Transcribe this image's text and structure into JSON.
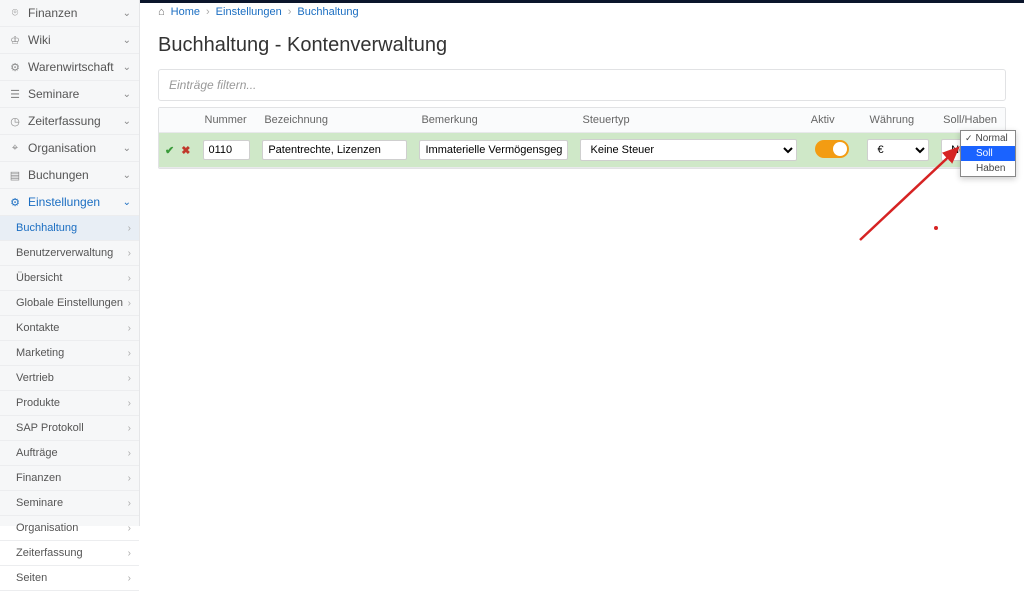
{
  "sidebar": {
    "items": [
      {
        "icon": "⌾",
        "label": "Finanzen"
      },
      {
        "icon": "♔",
        "label": "Wiki"
      },
      {
        "icon": "⚙",
        "label": "Warenwirtschaft"
      },
      {
        "icon": "☰",
        "label": "Seminare"
      },
      {
        "icon": "◷",
        "label": "Zeiterfassung"
      },
      {
        "icon": "⌖",
        "label": "Organisation"
      },
      {
        "icon": "▤",
        "label": "Buchungen"
      },
      {
        "icon": "⚙",
        "label": "Einstellungen",
        "active": true
      }
    ],
    "subitems": [
      {
        "label": "Buchhaltung",
        "active": true
      },
      {
        "label": "Benutzerverwaltung"
      },
      {
        "label": "Übersicht"
      },
      {
        "label": "Globale Einstellungen"
      },
      {
        "label": "Kontakte"
      },
      {
        "label": "Marketing"
      },
      {
        "label": "Vertrieb"
      },
      {
        "label": "Produkte"
      },
      {
        "label": "SAP Protokoll"
      },
      {
        "label": "Aufträge"
      },
      {
        "label": "Finanzen"
      },
      {
        "label": "Seminare"
      },
      {
        "label": "Organisation"
      },
      {
        "label": "Zeiterfassung"
      },
      {
        "label": "Seiten"
      }
    ]
  },
  "breadcrumb": {
    "home": "Home",
    "mid": "Einstellungen",
    "last": "Buchhaltung"
  },
  "page": {
    "title": "Buchhaltung - Kontenverwaltung",
    "filter_placeholder": "Einträge filtern..."
  },
  "table": {
    "headers": {
      "nummer": "Nummer",
      "bezeichnung": "Bezeichnung",
      "bemerkung": "Bemerkung",
      "steuertyp": "Steuertyp",
      "aktiv": "Aktiv",
      "waehrung": "Währung",
      "sollhaben": "Soll/Haben"
    },
    "row": {
      "nummer": "0110",
      "bezeichnung": "Patentrechte, Lizenzen",
      "bemerkung": "Immaterielle Vermögensgegenstände",
      "steuertyp": "Keine Steuer",
      "aktiv": true,
      "waehrung": "€",
      "sollhaben": "Normal"
    }
  },
  "dropdown": {
    "options": [
      "Normal",
      "Soll",
      "Haben"
    ],
    "selected": "Normal",
    "highlighted": "Soll"
  }
}
